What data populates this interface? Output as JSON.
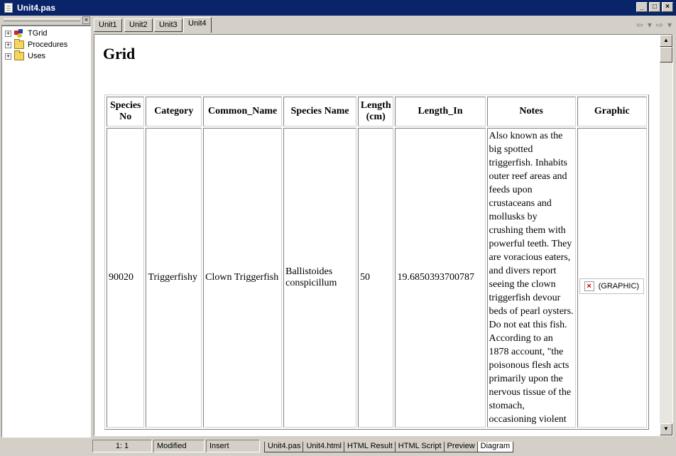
{
  "window": {
    "title": "Unit4.pas"
  },
  "tree": {
    "items": [
      {
        "label": "TGrid",
        "icon": "component-icon"
      },
      {
        "label": "Procedures",
        "icon": "folder-icon"
      },
      {
        "label": "Uses",
        "icon": "folder-icon"
      }
    ]
  },
  "tabs": [
    "Unit1",
    "Unit2",
    "Unit3",
    "Unit4"
  ],
  "active_tab": "Unit4",
  "page": {
    "heading": "Grid",
    "columns": [
      "Species No",
      "Category",
      "Common_Name",
      "Species Name",
      "Length (cm)",
      "Length_In",
      "Notes",
      "Graphic"
    ],
    "row": {
      "species_no": "90020",
      "category": "Triggerfishy",
      "common_name": "Clown Triggerfish",
      "species_name": "Ballistoides conspicillum",
      "length_cm": "50",
      "length_in": "19.6850393700787",
      "notes": "Also known as the big spotted triggerfish. Inhabits outer reef areas and feeds upon crustaceans and mollusks by crushing them with powerful teeth. They are voracious eaters, and divers report seeing the clown triggerfish devour beds of pearl oysters. Do not eat this fish. According to an 1878 account, \"the poisonous flesh acts primarily upon the nervous tissue of the stomach, occasioning violent",
      "graphic": "(GRAPHIC)"
    }
  },
  "status": {
    "position": "1:   1",
    "modified": "Modified",
    "mode": "Insert"
  },
  "bottom_tabs": [
    "Unit4.pas",
    "Unit4.html",
    "HTML Result",
    "HTML Script",
    "Preview",
    "Diagram"
  ],
  "active_bottom_tab": "Diagram"
}
